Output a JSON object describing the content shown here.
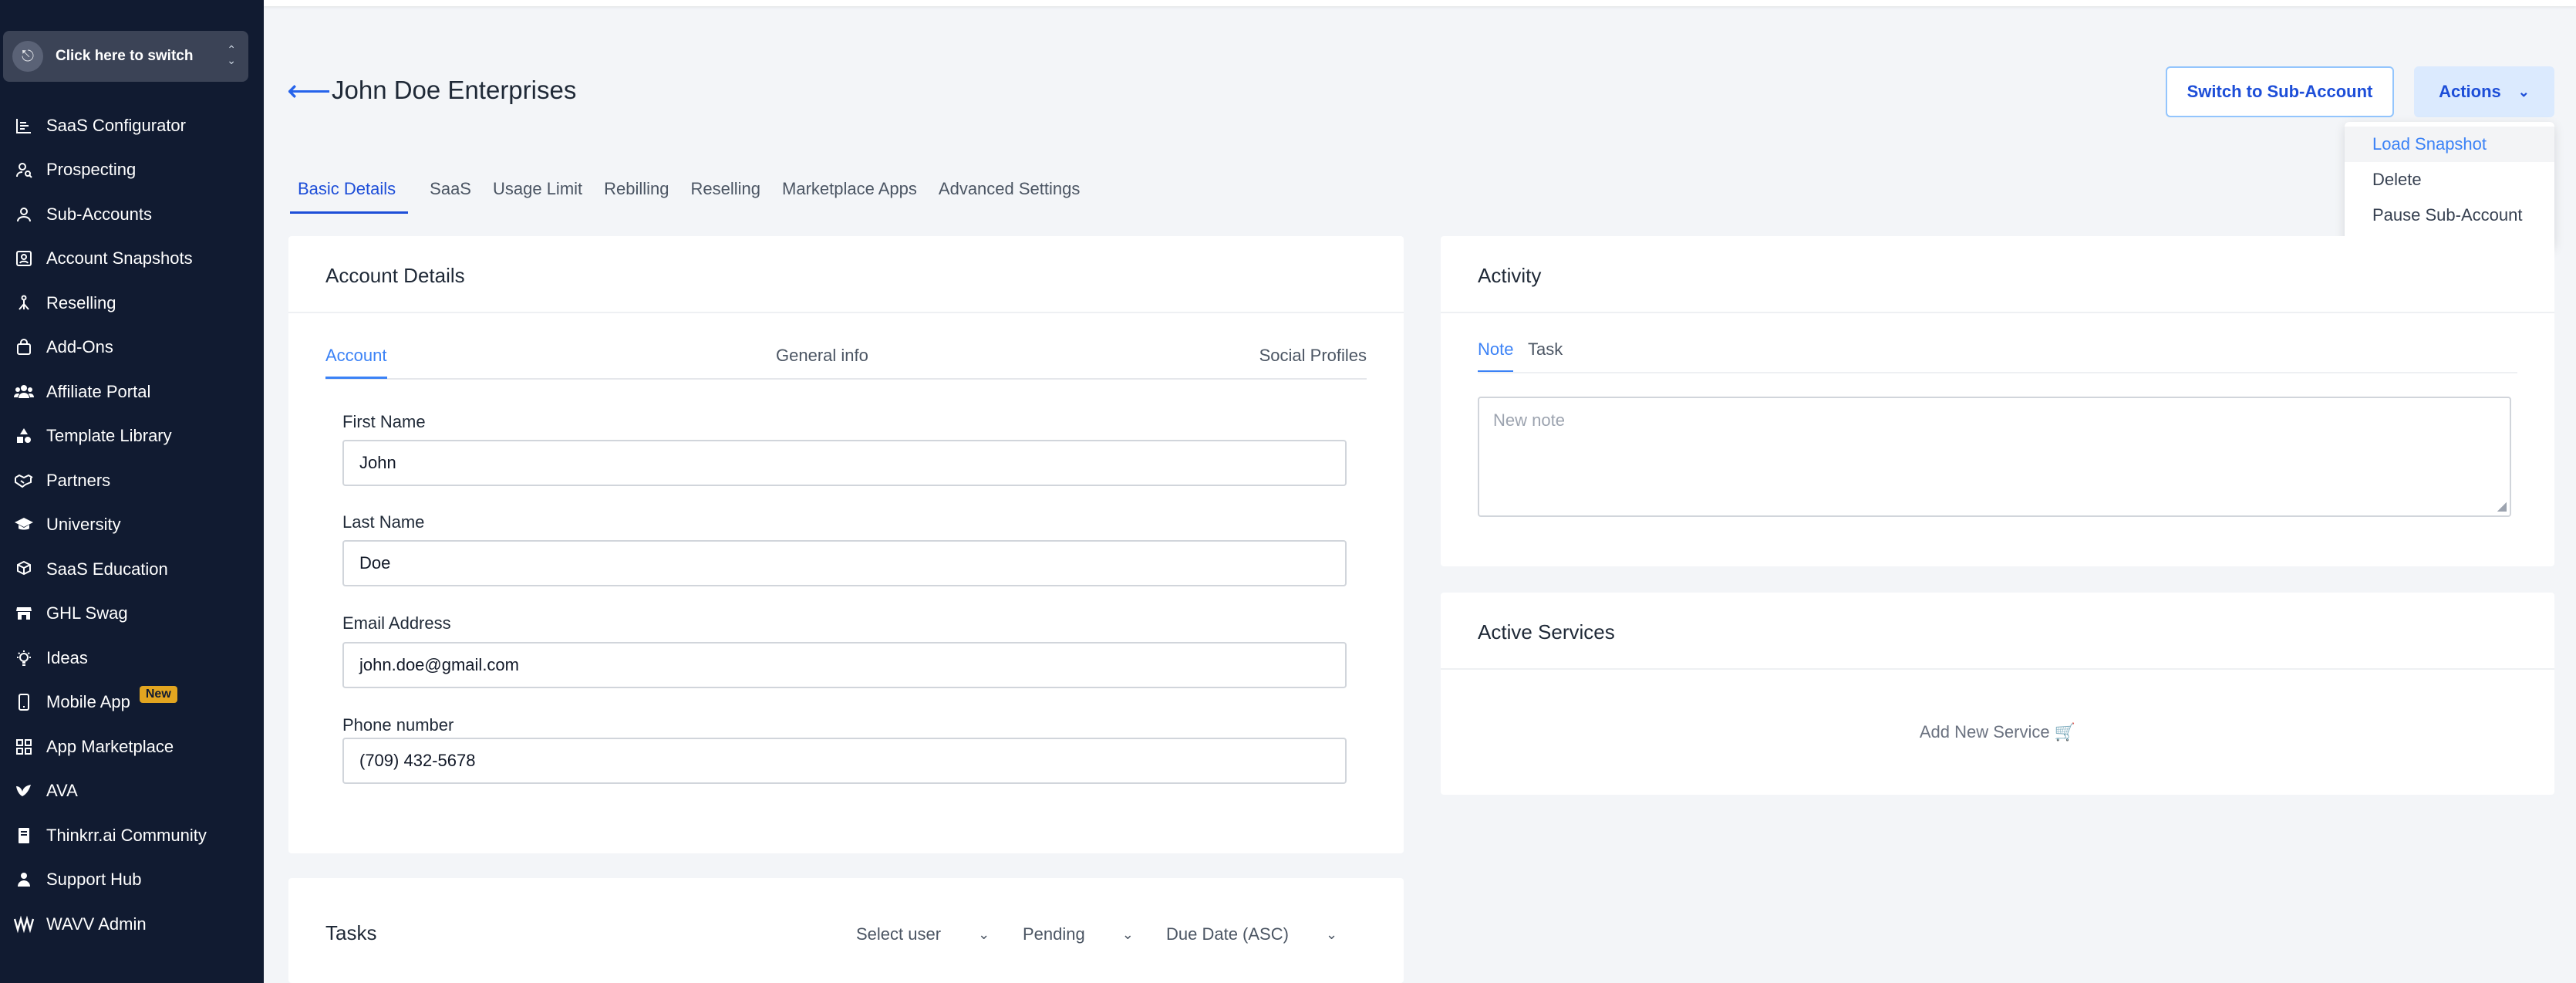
{
  "sidebar": {
    "switcher_label": "Click here to switch",
    "items": [
      {
        "label": "SaaS Configurator",
        "icon": "chart-bars-icon"
      },
      {
        "label": "Prospecting",
        "icon": "user-search-icon"
      },
      {
        "label": "Sub-Accounts",
        "icon": "user-icon"
      },
      {
        "label": "Account Snapshots",
        "icon": "snapshot-icon"
      },
      {
        "label": "Reselling",
        "icon": "network-icon"
      },
      {
        "label": "Add-Ons",
        "icon": "bag-icon"
      },
      {
        "label": "Affiliate Portal",
        "icon": "users-icon"
      },
      {
        "label": "Template Library",
        "icon": "shapes-icon"
      },
      {
        "label": "Partners",
        "icon": "handshake-icon"
      },
      {
        "label": "University",
        "icon": "graduation-cap-icon"
      },
      {
        "label": "SaaS Education",
        "icon": "cubes-icon"
      },
      {
        "label": "GHL Swag",
        "icon": "store-icon"
      },
      {
        "label": "Ideas",
        "icon": "lightbulb-icon"
      },
      {
        "label": "Mobile App",
        "icon": "mobile-icon",
        "badge": "New"
      },
      {
        "label": "App Marketplace",
        "icon": "grid-icon"
      },
      {
        "label": "AVA",
        "icon": "bird-icon"
      },
      {
        "label": "Thinkrr.ai Community",
        "icon": "book-icon"
      },
      {
        "label": "Support Hub",
        "icon": "person-icon"
      },
      {
        "label": "WAVV Admin",
        "icon": "wave-icon"
      }
    ]
  },
  "header": {
    "title": "John Doe Enterprises",
    "switch_button": "Switch to Sub-Account",
    "actions_button": "Actions"
  },
  "actions_menu": [
    "Load Snapshot",
    "Delete",
    "Pause Sub-Account"
  ],
  "tabs": [
    "Basic Details",
    "SaaS",
    "Usage Limit",
    "Rebilling",
    "Reselling",
    "Marketplace Apps",
    "Advanced Settings"
  ],
  "account_details": {
    "title": "Account Details",
    "subtabs": [
      "Account",
      "General info",
      "Social Profiles"
    ],
    "fields": [
      {
        "label": "First Name",
        "value": "John"
      },
      {
        "label": "Last Name",
        "value": "Doe"
      },
      {
        "label": "Email Address",
        "value": "john.doe@gmail.com"
      },
      {
        "label": "Phone number",
        "value": "(709) 432-5678"
      }
    ]
  },
  "activity": {
    "title": "Activity",
    "tabs": [
      "Note",
      "Task"
    ],
    "note_placeholder": "New note"
  },
  "active_services": {
    "title": "Active Services",
    "add_label": "Add New Service"
  },
  "tasks": {
    "title": "Tasks",
    "filters": [
      "Select user",
      "Pending",
      "Due Date (ASC)"
    ]
  },
  "colors": {
    "sidebar_bg": "#111b31",
    "accent": "#1d4ed8",
    "badge": "#e2a520"
  }
}
